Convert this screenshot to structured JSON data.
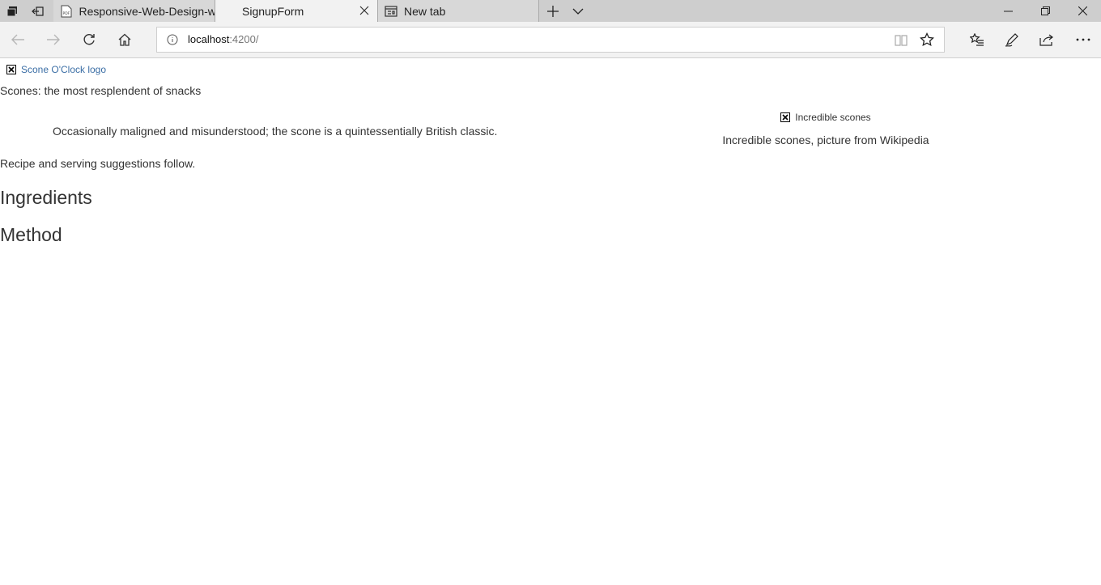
{
  "browser": {
    "tabs": [
      {
        "title": "Responsive-Web-Design-wi",
        "active": false
      },
      {
        "title": "SignupForm",
        "active": true
      },
      {
        "title": "New tab",
        "active": false
      }
    ],
    "url_host": "localhost",
    "url_port": ":4200/"
  },
  "page": {
    "logo_alt": "Scone O'Clock logo",
    "tagline": "Scones: the most resplendent of snacks",
    "quote": "Occasionally maligned and misunderstood; the scone is a quintessentially British classic.",
    "figure_alt": "Incredible scones",
    "figure_caption": "Incredible scones, picture from Wikipedia",
    "recipe_note": "Recipe and serving suggestions follow.",
    "ingredients_heading": "Ingredients",
    "method_heading": "Method"
  }
}
